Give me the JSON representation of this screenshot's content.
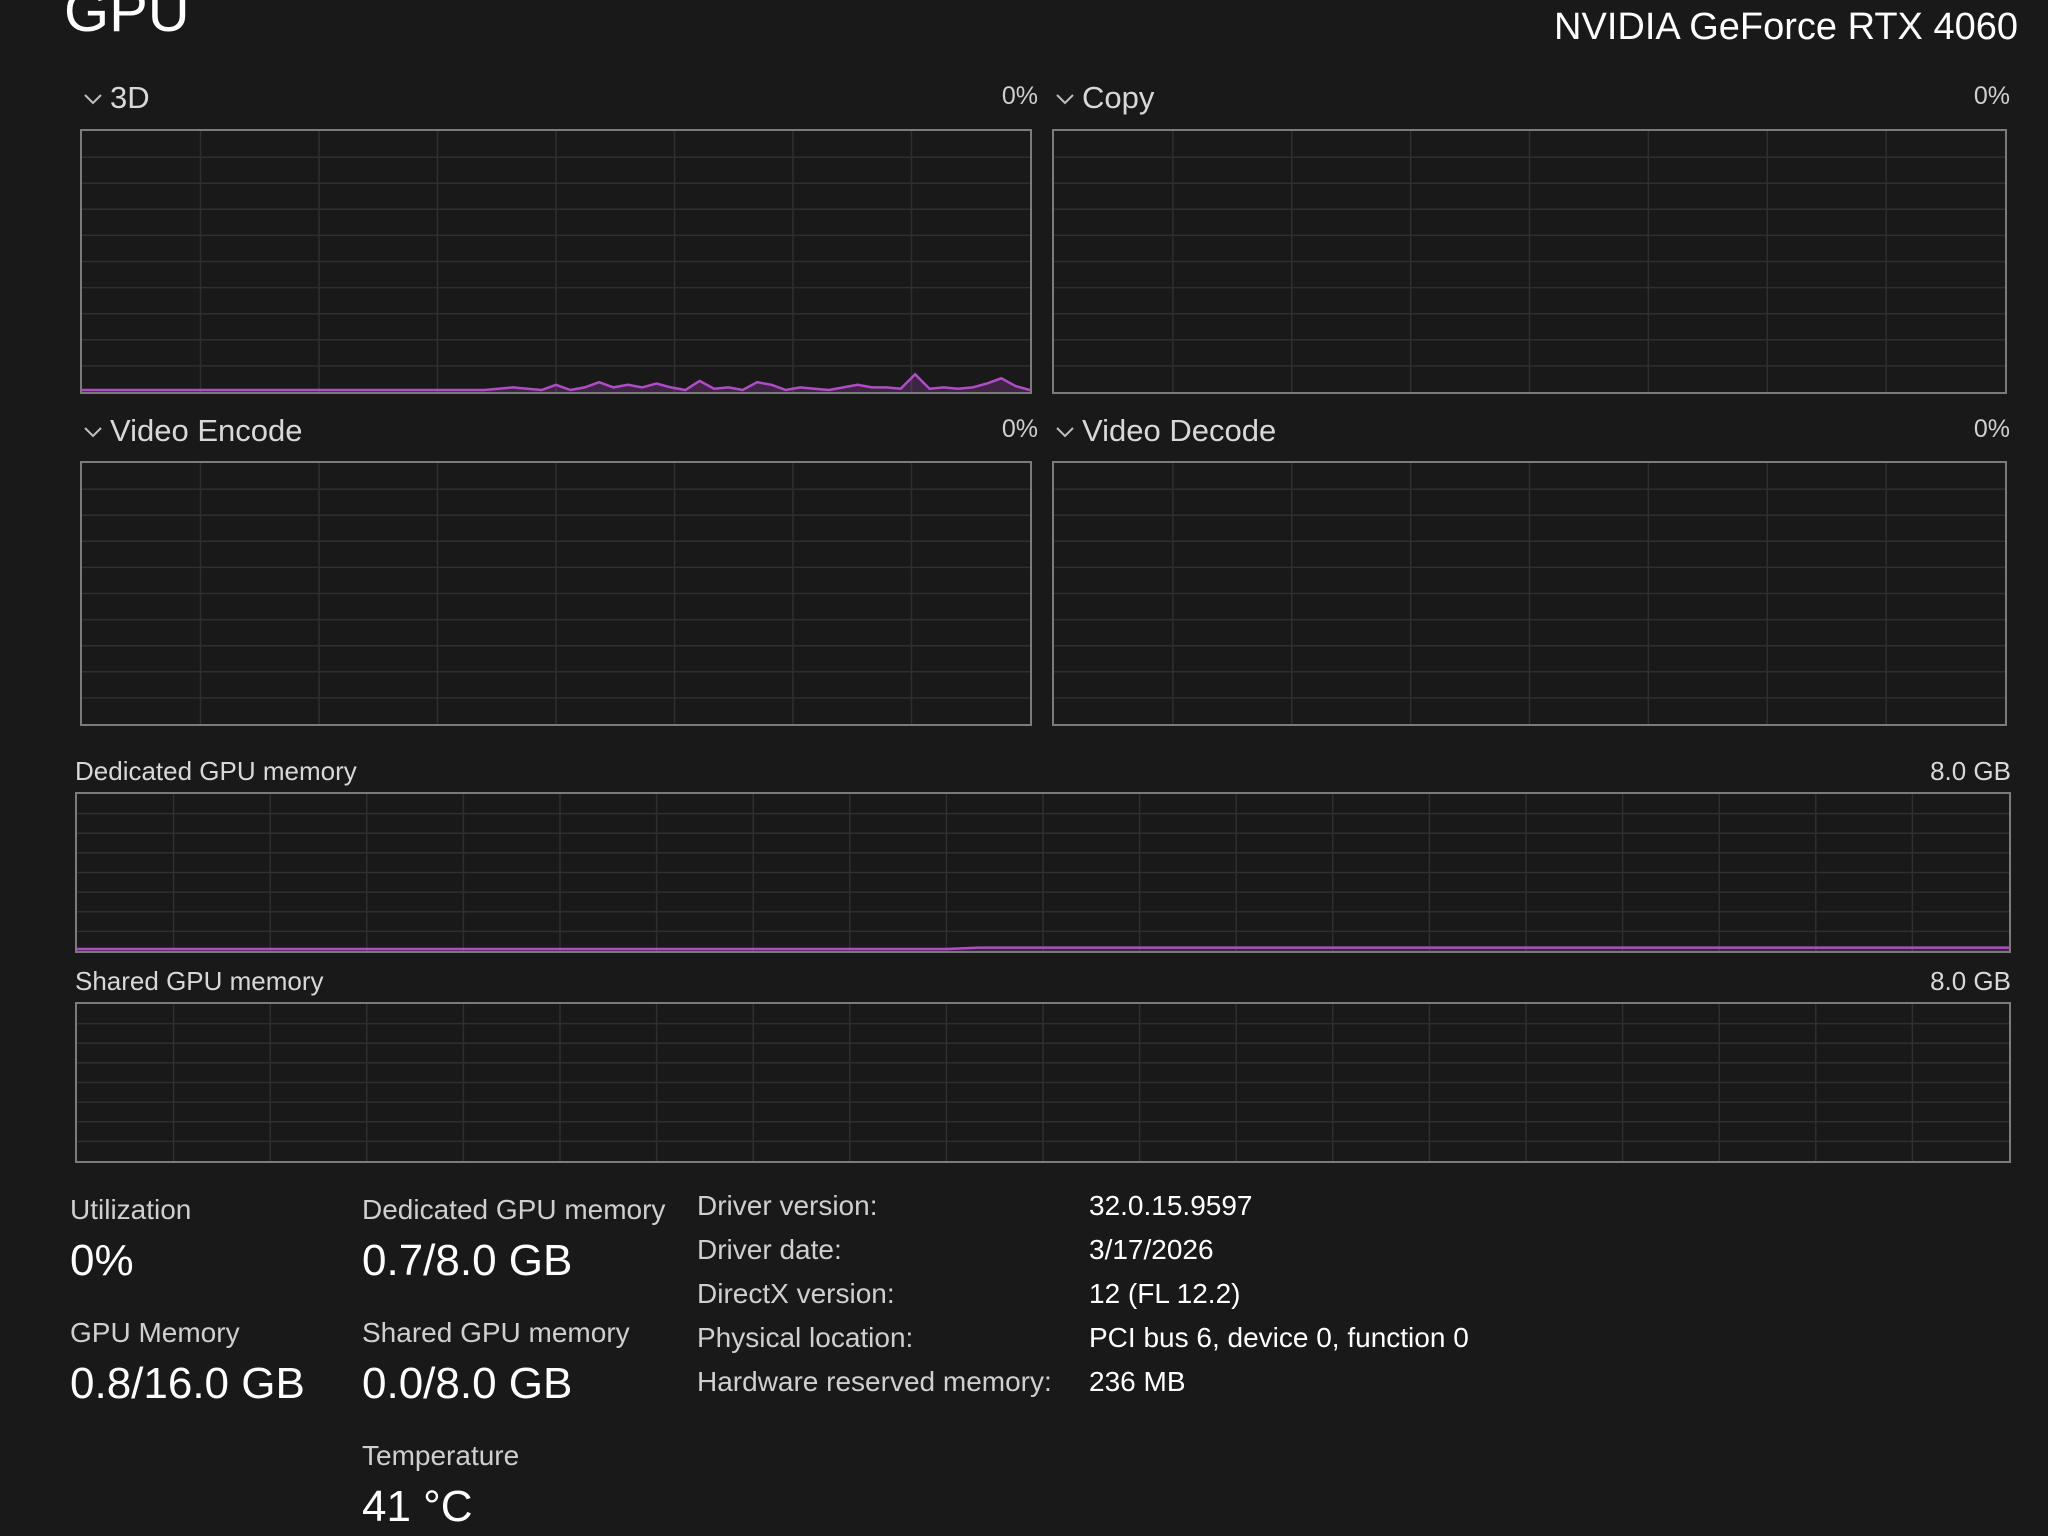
{
  "header": {
    "title": "GPU",
    "device_name": "NVIDIA GeForce RTX 4060"
  },
  "colors": {
    "background": "#191919",
    "graph_border": "#7b7b7b",
    "grid": "#2f2f2f",
    "accent": "#b04cc8"
  },
  "engines": [
    {
      "label": "3D",
      "percent": "0%",
      "icon": "chevron-down-icon",
      "samples": [
        0,
        0,
        0,
        0,
        0,
        0,
        0,
        0,
        0,
        0,
        0,
        0,
        0,
        0,
        0,
        0,
        0,
        0,
        0,
        0,
        0,
        0,
        0,
        0,
        0,
        0,
        0,
        0,
        0,
        0.5,
        1,
        0.5,
        0,
        2,
        0,
        1,
        3,
        1,
        2,
        1,
        2.5,
        1,
        0,
        3.5,
        0.5,
        1,
        0,
        3,
        2,
        0,
        1,
        0.5,
        0,
        1,
        2,
        1,
        1,
        0.5,
        6,
        0.5,
        1,
        0.5,
        1,
        2.5,
        4.5,
        1.5,
        0
      ]
    },
    {
      "label": "Copy",
      "percent": "0%",
      "icon": "chevron-down-icon",
      "samples": []
    },
    {
      "label": "Video Encode",
      "percent": "0%",
      "icon": "chevron-down-icon",
      "samples": []
    },
    {
      "label": "Video Decode",
      "percent": "0%",
      "icon": "chevron-down-icon",
      "samples": []
    }
  ],
  "memory_graphs": [
    {
      "label": "Dedicated GPU memory",
      "capacity": "8.0 GB",
      "samples": [
        0,
        0,
        0,
        0,
        0,
        0,
        0,
        0,
        0,
        0,
        0,
        0,
        0,
        0,
        0,
        0,
        0,
        0,
        0,
        0,
        0,
        0,
        0,
        0,
        0,
        0,
        0,
        0,
        0.7,
        0.7,
        0.7,
        0.7,
        0.7,
        0.7,
        0.7,
        0.7,
        0.7,
        0.7,
        0.7,
        0.7,
        0.7,
        0.7,
        0.7,
        0.7,
        0.7,
        0.7,
        0.7,
        0.7,
        0.7,
        0.7,
        0.7,
        0.7,
        0.7,
        0.7,
        0.7,
        0.7,
        0.7,
        0.7,
        0.7,
        0.7,
        0.7
      ],
      "max": 8.0
    },
    {
      "label": "Shared GPU memory",
      "capacity": "8.0 GB",
      "samples": [],
      "max": 8.0
    }
  ],
  "stats": {
    "utilization_label": "Utilization",
    "utilization_value": "0%",
    "dedicated_label": "Dedicated GPU memory",
    "dedicated_value": "0.7/8.0 GB",
    "gpu_memory_label": "GPU Memory",
    "gpu_memory_value": "0.8/16.0 GB",
    "shared_label": "Shared GPU memory",
    "shared_value": "0.0/8.0 GB",
    "temperature_label": "Temperature",
    "temperature_value": "41 °C"
  },
  "info": [
    {
      "key": "Driver version:",
      "value": "32.0.15.9597"
    },
    {
      "key": "Driver date:",
      "value": "3/17/2026"
    },
    {
      "key": "DirectX version:",
      "value": "12 (FL 12.2)"
    },
    {
      "key": "Physical location:",
      "value": "PCI bus 6, device 0, function 0"
    },
    {
      "key": "Hardware reserved memory:",
      "value": "236 MB"
    }
  ]
}
